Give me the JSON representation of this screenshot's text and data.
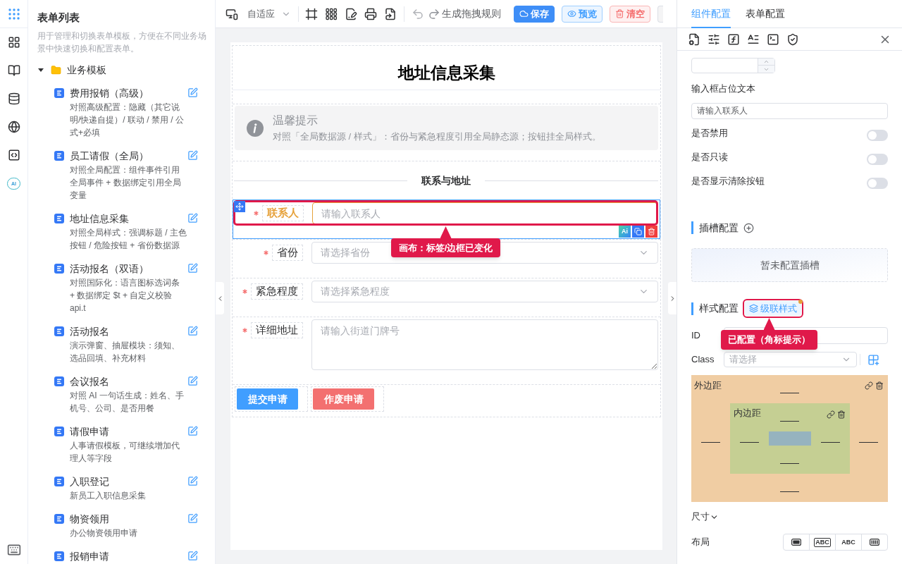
{
  "rail": {
    "ai_label": "AI"
  },
  "sidebar": {
    "title": "表单列表",
    "description": "用于管理和切换表单模板，方便在不同业务场景中快速切换和配置表单。",
    "folder": {
      "label": "业务模板",
      "expanded": true,
      "children": [
        {
          "title": "费用报销（高级）",
          "description": "对照高级配置：隐藏（其它说明/快递自提）/ 联动 / 禁用 / 公式+必填"
        },
        {
          "title": "员工请假（全局）",
          "description": "对照全局配置：组件事件引用全局事件 + 数据绑定引用全局变量"
        },
        {
          "title": "地址信息采集",
          "description": "对照全局样式：强调标题 / 主色按钮 / 危险按钮 + 省份数据源"
        },
        {
          "title": "活动报名（双语）",
          "description": "对照国际化：语言图标选词条 + 数据绑定 $t + 自定义校验 api.t"
        },
        {
          "title": "活动报名",
          "description": "演示弹窗、抽屉模块：须知、选品回填、补充材料"
        },
        {
          "title": "会议报名",
          "description": "对照 AI 一句话生成：姓名、手机号、公司、是否用餐"
        },
        {
          "title": "请假申请",
          "description": "人事请假模板，可继续增加代理人等字段"
        },
        {
          "title": "入职登记",
          "description": "新员工入职信息采集"
        },
        {
          "title": "物资领用",
          "description": "办公物资领用申请"
        },
        {
          "title": "报销申请"
        }
      ]
    }
  },
  "toolbar": {
    "device_mode": "自适应",
    "rule_label": "生成拖拽规则",
    "buttons": [
      {
        "label": "保存",
        "kind": "primary"
      },
      {
        "label": "预览",
        "kind": "info"
      },
      {
        "label": "清空",
        "kind": "danger"
      }
    ]
  },
  "form": {
    "title": "地址信息采集",
    "notice": {
      "title": "温馨提示",
      "text": "对照「全局数据源 / 样式」：省份与紧急程度引用全局静态源；按钮挂全局样式。"
    },
    "section_title": "联系与地址",
    "fields": [
      {
        "kind": "input",
        "label": "联系人",
        "required": true,
        "placeholder": "请输入联系人",
        "selected": true,
        "custom_style": true,
        "highlighted": true,
        "callout": "画布：标签/边框已变化"
      },
      {
        "kind": "select",
        "label": "省份",
        "required": true,
        "placeholder": "请选择省份",
        "selected": false,
        "custom_style": false,
        "highlighted": false
      },
      {
        "kind": "select",
        "label": "紧急程度",
        "required": true,
        "placeholder": "请选择紧急程度",
        "selected": false,
        "custom_style": false,
        "highlighted": false
      },
      {
        "kind": "textarea",
        "label": "详细地址",
        "required": true,
        "placeholder": "请输入街道门牌号",
        "selected": false,
        "custom_style": false,
        "highlighted": false
      }
    ],
    "field_actions": {
      "ai_label": "Ai"
    },
    "buttons": [
      {
        "label": "提交申请",
        "kind": "primary"
      },
      {
        "label": "作废申请",
        "kind": "danger"
      }
    ]
  },
  "right_panel": {
    "tabs": [
      {
        "label": "组件配置",
        "selected": true
      },
      {
        "label": "表单配置",
        "selected": false
      }
    ],
    "placeholder_setting": {
      "label": "输入框占位文本",
      "value": "请输入联系人"
    },
    "switches": [
      {
        "label": "是否禁用",
        "on": false
      },
      {
        "label": "是否只读",
        "on": false
      },
      {
        "label": "是否显示清除按钮",
        "on": false
      }
    ],
    "slots": {
      "title": "插槽配置",
      "empty_text": "暂未配置插槽"
    },
    "style": {
      "title": "样式配置",
      "cascade_button": {
        "label": "级联样式",
        "configured": true,
        "highlighted": true
      },
      "callout": "已配置（角标提示）",
      "id_label": "ID",
      "class_label": "Class",
      "class_placeholder": "请选择",
      "margin_label": "外边距",
      "padding_label": "内边距",
      "size_label": "尺寸",
      "layout_label": "布局",
      "layout_options": [
        {
          "kind": "block"
        },
        {
          "kind": "inline-block",
          "text": "ABC"
        },
        {
          "kind": "inline",
          "text": "ABC"
        },
        {
          "kind": "flex"
        }
      ]
    }
  }
}
